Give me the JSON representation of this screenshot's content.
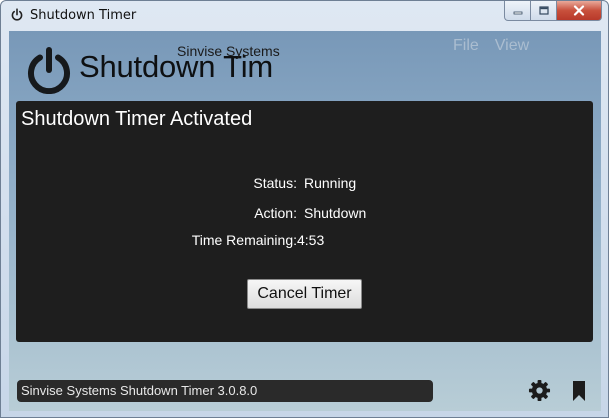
{
  "window": {
    "title": "Shutdown Timer",
    "icon": "power-icon",
    "controls": [
      "minimize-icon",
      "maximize-icon",
      "close-icon"
    ]
  },
  "header": {
    "app_name": "Shutdown Timer",
    "company": "Sinvise Systems",
    "logo_icon": "power-icon",
    "menu": [
      {
        "label": "File"
      },
      {
        "label": "View"
      }
    ]
  },
  "panel": {
    "title": "Shutdown Timer Activated",
    "status_label": "Status:",
    "status_value": "Running",
    "action_label": "Action:",
    "action_value": "Shutdown",
    "remaining_label": "Time Remaining:",
    "remaining_value": "4:53",
    "cancel_label": "Cancel Timer"
  },
  "footer": {
    "status_text": "Sinvise Systems Shutdown Timer 3.0.8.0",
    "settings_icon": "gear-icon",
    "bookmark_icon": "bookmark-icon"
  },
  "colors": {
    "panel_bg": "#1e1e1e",
    "client_top": "#7898b8",
    "client_bottom": "#b8cdd6",
    "close_button": "#c8503c"
  }
}
